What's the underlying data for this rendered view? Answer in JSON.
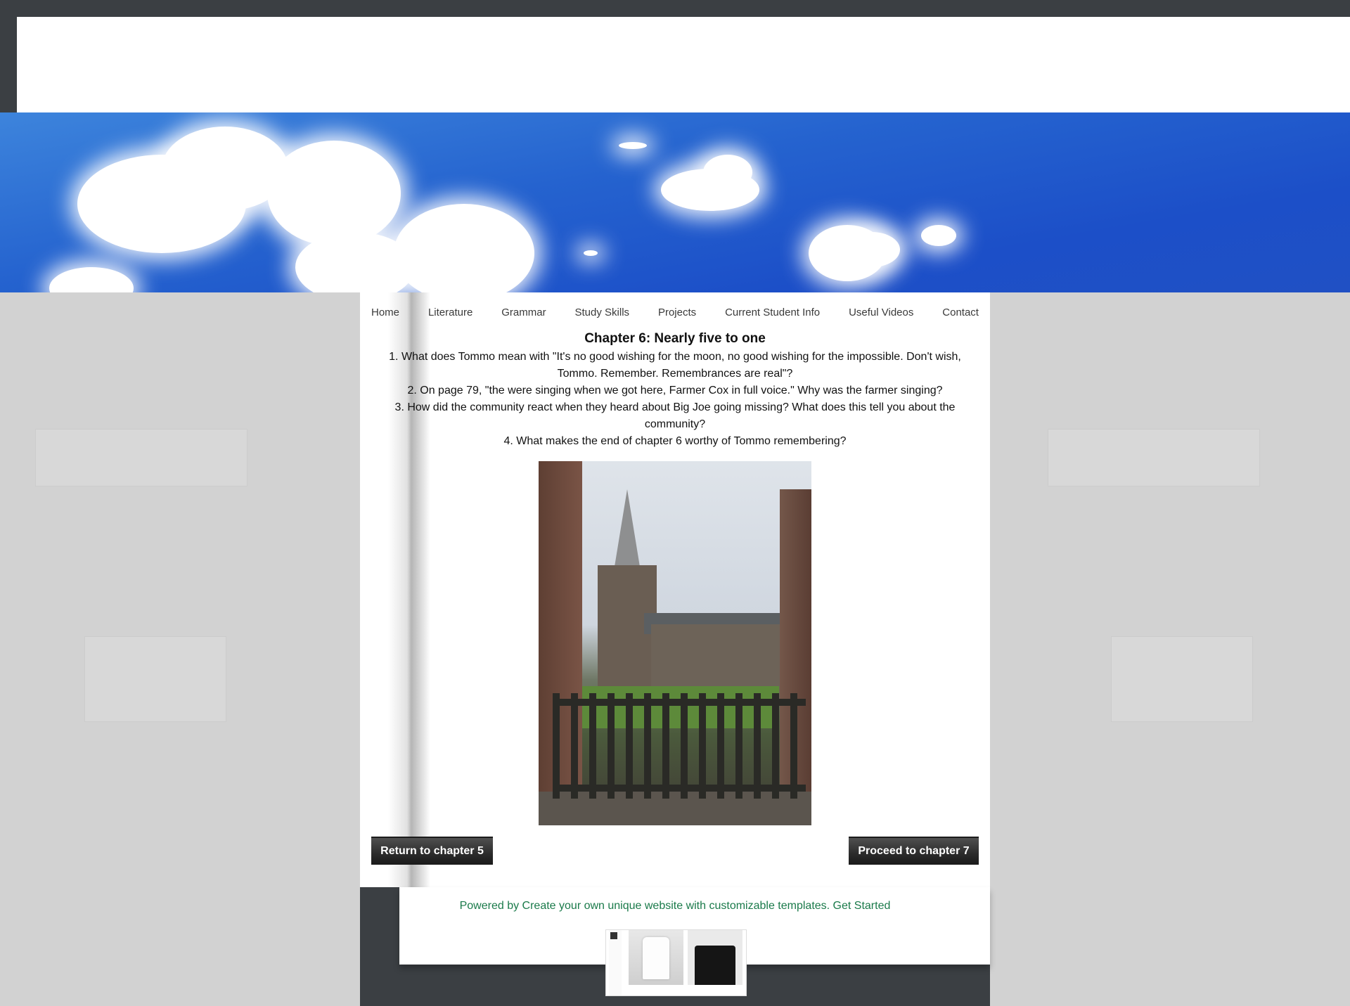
{
  "nav": {
    "items": [
      "Home",
      "Literature",
      "Grammar",
      "Study Skills",
      "Projects",
      "Current Student Info",
      "Useful Videos",
      "Contact"
    ]
  },
  "chapter": {
    "title": "Chapter 6: Nearly five to one",
    "questions": [
      "1. What does Tommo mean with \"It's no good wishing for the moon, no good wishing for the impossible. Don't wish, Tommo. Remember. Remembrances are real\"?",
      "2. On page 79, \"the were singing when we got here, Farmer Cox in full voice.\" Why was the farmer singing?",
      "3. How did the community react when they heard about Big Joe going missing? What does this tell you about the community?",
      "4. What makes the end of chapter 6 worthy of Tommo remembering?"
    ]
  },
  "buttons": {
    "prev_label": "Return to chapter 5",
    "next_label": "Proceed to chapter 7"
  },
  "footer": {
    "powered_text": "Powered by Create your own unique website with customizable templates. Get Started",
    "link_color": "#1a7a4a"
  },
  "colors": {
    "page_bg": "#d2d2d2",
    "frame": "#3b3f43",
    "sky": "#1c4fc8"
  }
}
